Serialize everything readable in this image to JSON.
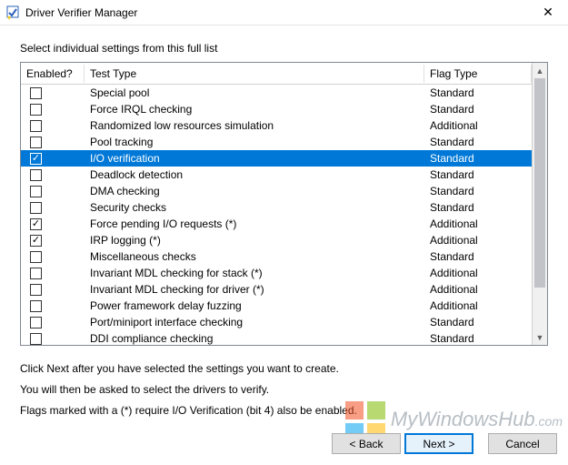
{
  "window": {
    "title": "Driver Verifier Manager",
    "close_glyph": "✕"
  },
  "instruction": "Select individual settings from this full list",
  "columns": {
    "enabled": "Enabled?",
    "test_type": "Test Type",
    "flag_type": "Flag Type"
  },
  "rows": [
    {
      "enabled": false,
      "test_type": "Special pool",
      "flag_type": "Standard",
      "selected": false
    },
    {
      "enabled": false,
      "test_type": "Force IRQL checking",
      "flag_type": "Standard",
      "selected": false
    },
    {
      "enabled": false,
      "test_type": "Randomized low resources simulation",
      "flag_type": "Additional",
      "selected": false
    },
    {
      "enabled": false,
      "test_type": "Pool tracking",
      "flag_type": "Standard",
      "selected": false
    },
    {
      "enabled": true,
      "test_type": "I/O verification",
      "flag_type": "Standard",
      "selected": true
    },
    {
      "enabled": false,
      "test_type": "Deadlock detection",
      "flag_type": "Standard",
      "selected": false
    },
    {
      "enabled": false,
      "test_type": "DMA checking",
      "flag_type": "Standard",
      "selected": false
    },
    {
      "enabled": false,
      "test_type": "Security checks",
      "flag_type": "Standard",
      "selected": false
    },
    {
      "enabled": true,
      "test_type": "Force pending I/O requests (*)",
      "flag_type": "Additional",
      "selected": false
    },
    {
      "enabled": true,
      "test_type": "IRP logging (*)",
      "flag_type": "Additional",
      "selected": false
    },
    {
      "enabled": false,
      "test_type": "Miscellaneous checks",
      "flag_type": "Standard",
      "selected": false
    },
    {
      "enabled": false,
      "test_type": "Invariant MDL checking for stack (*)",
      "flag_type": "Additional",
      "selected": false
    },
    {
      "enabled": false,
      "test_type": "Invariant MDL checking for driver (*)",
      "flag_type": "Additional",
      "selected": false
    },
    {
      "enabled": false,
      "test_type": "Power framework delay fuzzing",
      "flag_type": "Additional",
      "selected": false
    },
    {
      "enabled": false,
      "test_type": "Port/miniport interface checking",
      "flag_type": "Standard",
      "selected": false
    },
    {
      "enabled": false,
      "test_type": "DDI compliance checking",
      "flag_type": "Standard",
      "selected": false
    }
  ],
  "help": {
    "line1": "Click Next after you have selected the settings you want to create.",
    "line2": "You will then be asked to select the drivers to verify.",
    "line3": "Flags marked with a (*) require I/O Verification (bit 4) also be enabled."
  },
  "buttons": {
    "back": "< Back",
    "next": "Next >",
    "cancel": "Cancel"
  },
  "scroll": {
    "up_glyph": "▲",
    "down_glyph": "▼"
  },
  "watermark": {
    "text": "MyWindowsHub",
    "sub": ".com",
    "colors": {
      "tl": "#f25022",
      "tr": "#7fba00",
      "bl": "#00a4ef",
      "br": "#ffb900"
    }
  },
  "check_glyph": "✓"
}
